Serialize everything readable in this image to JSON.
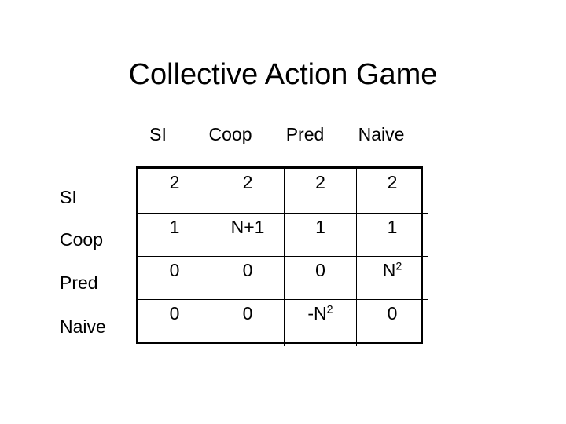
{
  "slide": {
    "title": "Collective Action Game",
    "background_color": "#ffffff",
    "text_color": "#000000"
  },
  "table": {
    "border_color": "#000000",
    "corner_label": "",
    "column_headers": [
      "SI",
      "Coop",
      "Pred",
      "Naive"
    ],
    "row_headers": [
      "SI",
      "Coop",
      "Pred",
      "Naive"
    ],
    "rows": [
      {
        "label": "SI",
        "cells": [
          "2",
          "2",
          "2",
          "2"
        ]
      },
      {
        "label": "Coop",
        "cells": [
          "1",
          "N+1",
          "1",
          "1"
        ]
      },
      {
        "label": "Pred",
        "cells": [
          "0",
          "0",
          "0",
          "N²"
        ]
      },
      {
        "label": "Naive",
        "cells": [
          "0",
          "0",
          "-N²",
          "0"
        ]
      }
    ]
  }
}
